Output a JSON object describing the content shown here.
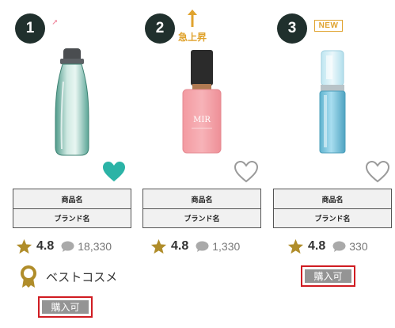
{
  "products": [
    {
      "rank": "1",
      "badge": "trend-up-arrow-icon",
      "product_name_label": "商品名",
      "brand_name_label": "ブランド名",
      "rating": "4.8",
      "review_count": "18,330",
      "favorited": true,
      "award_label": "ベストコスメ",
      "buy_label": "購入可"
    },
    {
      "rank": "2",
      "badge": "surge-icon",
      "badge_label": "急上昇",
      "product_name_label": "商品名",
      "brand_name_label": "ブランド名",
      "rating": "4.8",
      "review_count": "1,330",
      "favorited": false
    },
    {
      "rank": "3",
      "badge_label": "NEW",
      "product_name_label": "商品名",
      "brand_name_label": "ブランド名",
      "rating": "4.8",
      "review_count": "330",
      "favorited": false,
      "buy_label": "購入可"
    }
  ],
  "bottle_label_text": "MIR",
  "colors": {
    "rank_circle": "#20302d",
    "accent_gold": "#e0a32e",
    "heart_filled": "#2bb3a6",
    "heart_outline": "#9a9a9a",
    "star": "#b08d2a",
    "buy_button": "#949494",
    "buy_highlight_border": "#d01c22",
    "trend_arrow": "#f08aa0"
  }
}
